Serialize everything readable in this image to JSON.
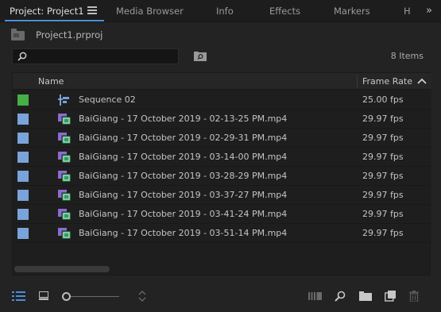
{
  "tabs": [
    {
      "label": "Project: Project1",
      "active": true
    },
    {
      "label": "Media Browser",
      "active": false
    },
    {
      "label": "Info",
      "active": false
    },
    {
      "label": "Effects",
      "active": false
    },
    {
      "label": "Markers",
      "active": false
    },
    {
      "label": "H",
      "active": false
    }
  ],
  "overflow_glyph": "»",
  "project": {
    "file_name": "Project1.prproj"
  },
  "search": {
    "value": "",
    "placeholder": ""
  },
  "item_count": "8 Items",
  "columns": {
    "name": "Name",
    "frame_rate": "Frame Rate"
  },
  "colors": {
    "accent": "#4a8fd8",
    "sequence_label": "#45b045",
    "clip_label": "#7ba3db"
  },
  "rows": [
    {
      "name": "Sequence 02",
      "frame_rate": "25.00 fps",
      "kind": "sequence",
      "label_color": "#45b045"
    },
    {
      "name": "BaiGiang - 17 October 2019 - 02-13-25 PM.mp4",
      "frame_rate": "29.97 fps",
      "kind": "clip",
      "label_color": "#7ba3db"
    },
    {
      "name": "BaiGiang - 17 October 2019 - 02-29-31 PM.mp4",
      "frame_rate": "29.97 fps",
      "kind": "clip",
      "label_color": "#7ba3db"
    },
    {
      "name": "BaiGiang - 17 October 2019 - 03-14-00 PM.mp4",
      "frame_rate": "29.97 fps",
      "kind": "clip",
      "label_color": "#7ba3db"
    },
    {
      "name": "BaiGiang - 17 October 2019 - 03-28-29 PM.mp4",
      "frame_rate": "29.97 fps",
      "kind": "clip",
      "label_color": "#7ba3db"
    },
    {
      "name": "BaiGiang - 17 October 2019 - 03-37-27 PM.mp4",
      "frame_rate": "29.97 fps",
      "kind": "clip",
      "label_color": "#7ba3db"
    },
    {
      "name": "BaiGiang - 17 October 2019 - 03-41-24 PM.mp4",
      "frame_rate": "29.97 fps",
      "kind": "clip",
      "label_color": "#7ba3db"
    },
    {
      "name": "BaiGiang - 17 October 2019 - 03-51-14 PM.mp4",
      "frame_rate": "29.97 fps",
      "kind": "clip",
      "label_color": "#7ba3db"
    }
  ],
  "icons": {
    "panel_menu": "hamburger-icon",
    "folder": "folder-icon",
    "search": "search-icon",
    "bin_search": "bin-search-icon",
    "sort": "chevron-up-icon",
    "sequence": "sequence-icon",
    "clip": "video-clip-icon",
    "list_view": "list-view-icon",
    "icon_view": "icon-view-icon",
    "automate": "automate-to-sequence-icon",
    "find": "find-icon",
    "new_bin": "new-bin-icon",
    "new_item": "new-item-icon",
    "clear": "trash-icon"
  }
}
